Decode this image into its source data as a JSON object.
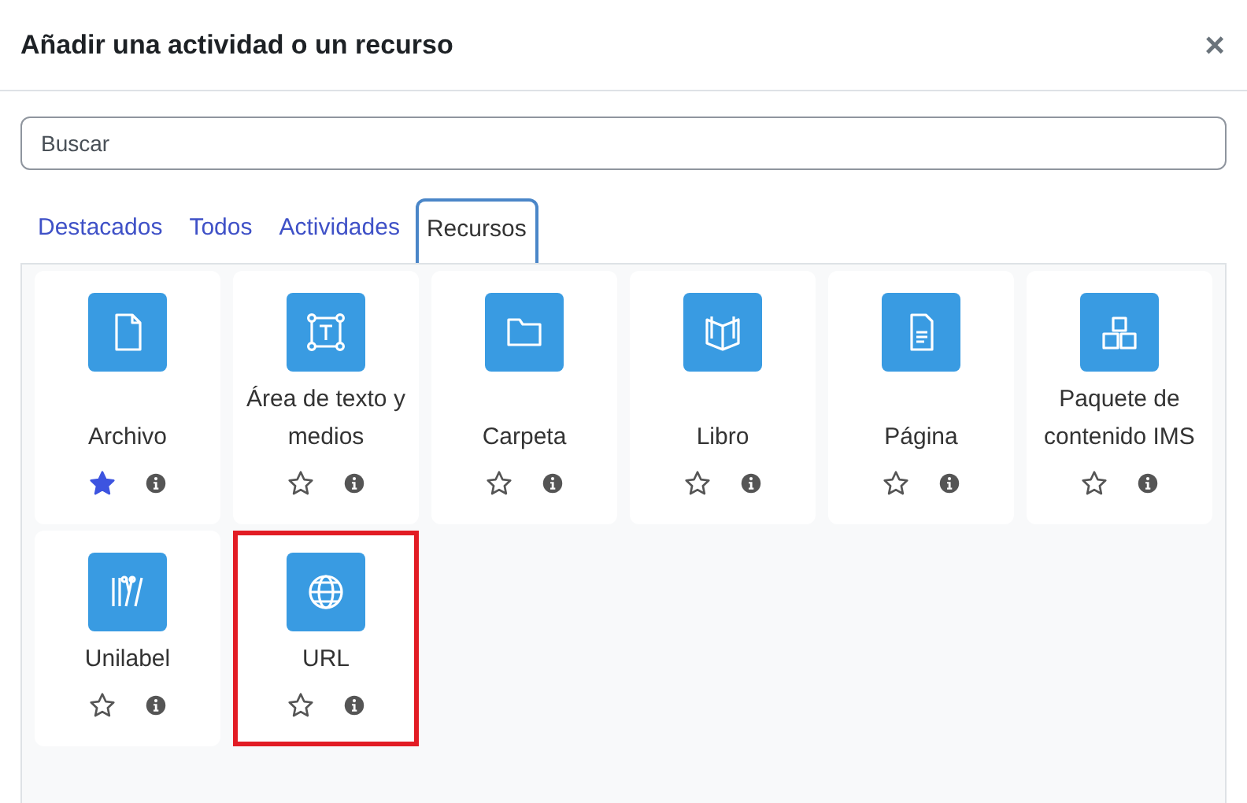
{
  "dialog": {
    "title": "Añadir una actividad o un recurso",
    "close": "×"
  },
  "search": {
    "placeholder": "Buscar"
  },
  "tabs": [
    {
      "label": "Destacados",
      "selected": false
    },
    {
      "label": "Todos",
      "selected": false
    },
    {
      "label": "Actividades",
      "selected": false
    },
    {
      "label": "Recursos",
      "selected": true
    }
  ],
  "items": [
    {
      "kind": "file",
      "name": "Archivo",
      "starred": true,
      "highlighted": false
    },
    {
      "kind": "textarea",
      "name": "Área de texto y medios",
      "starred": false,
      "highlighted": false
    },
    {
      "kind": "folder",
      "name": "Carpeta",
      "starred": false,
      "highlighted": false
    },
    {
      "kind": "book",
      "name": "Libro",
      "starred": false,
      "highlighted": false
    },
    {
      "kind": "page",
      "name": "Página",
      "starred": false,
      "highlighted": false
    },
    {
      "kind": "package",
      "name": "Paquete de contenido IMS",
      "starred": false,
      "highlighted": false
    },
    {
      "kind": "tools",
      "name": "Unilabel",
      "starred": false,
      "highlighted": false
    },
    {
      "kind": "globe",
      "name": "URL",
      "starred": false,
      "highlighted": true
    }
  ]
}
